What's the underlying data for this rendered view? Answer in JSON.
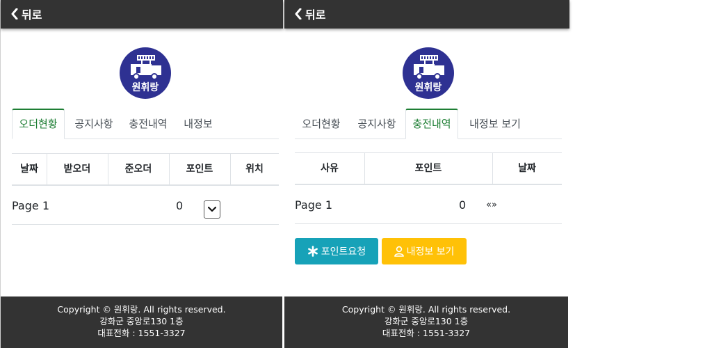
{
  "left": {
    "back_label": "뒤로",
    "logo_text": "원휘랑",
    "tabs": [
      {
        "label": "오더현황",
        "active": true
      },
      {
        "label": "공지사항",
        "active": false
      },
      {
        "label": "충전내역",
        "active": false
      },
      {
        "label": "내정보",
        "active": false
      }
    ],
    "table": {
      "headers": [
        "날짜",
        "받오더",
        "준오더",
        "포인트",
        "위치"
      ],
      "footer_row": {
        "page_label": "Page 1",
        "points": "0"
      }
    },
    "footer": {
      "copyright": "Copyright © 원휘랑. All rights reserved.",
      "address": "강화군 중앙로130 1층",
      "phone": "대표전화 : 1551-3327"
    }
  },
  "right": {
    "back_label": "뒤로",
    "logo_text": "원휘랑",
    "tabs": [
      {
        "label": "오더현황",
        "active": false
      },
      {
        "label": "공지사항",
        "active": false
      },
      {
        "label": "충전내역",
        "active": true
      },
      {
        "label": "내정보 보기",
        "active": false
      }
    ],
    "table": {
      "headers": [
        "사유",
        "포인트",
        "날짜"
      ],
      "footer_row": {
        "page_label": "Page 1",
        "points": "0",
        "pager": "«»"
      }
    },
    "buttons": {
      "point_request": "포인트요청",
      "my_info": "내정보 보기"
    },
    "footer": {
      "copyright": "Copyright © 원휘랑. All rights reserved.",
      "address": "강화군 중앙로130 1층",
      "phone": "대표전화 : 1551-3327"
    }
  },
  "colors": {
    "header_bg": "#333333",
    "logo_bg": "#2e3192",
    "active_tab": "#1e7e34",
    "point_button": "#17a2b8",
    "info_button": "#ffc107"
  },
  "icons": {
    "back": "chevron-left-icon",
    "point_request": "asterisk-icon",
    "my_info": "person-icon",
    "select": "chevron-down-icon"
  }
}
